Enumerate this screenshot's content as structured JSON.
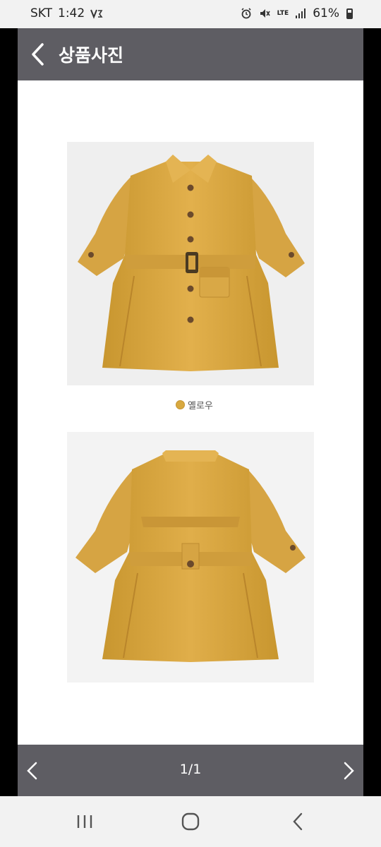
{
  "status": {
    "carrier": "SKT",
    "time": "1:42",
    "battery": "61%",
    "network": "LTE"
  },
  "header": {
    "title": "상품사진"
  },
  "product": {
    "color_label": "옐로우",
    "coat_color": "#d9a845",
    "swatch_color": "#d8a940"
  },
  "pager": {
    "count": "1/1"
  },
  "colors": {
    "header_bg": "#5e5d63",
    "background": "#ffffff"
  },
  "icons": {
    "back": "chevron-left-icon",
    "prev": "chevron-left-icon",
    "next": "chevron-right-icon",
    "recents": "recents-icon",
    "home": "home-icon",
    "system_back": "back-icon"
  }
}
